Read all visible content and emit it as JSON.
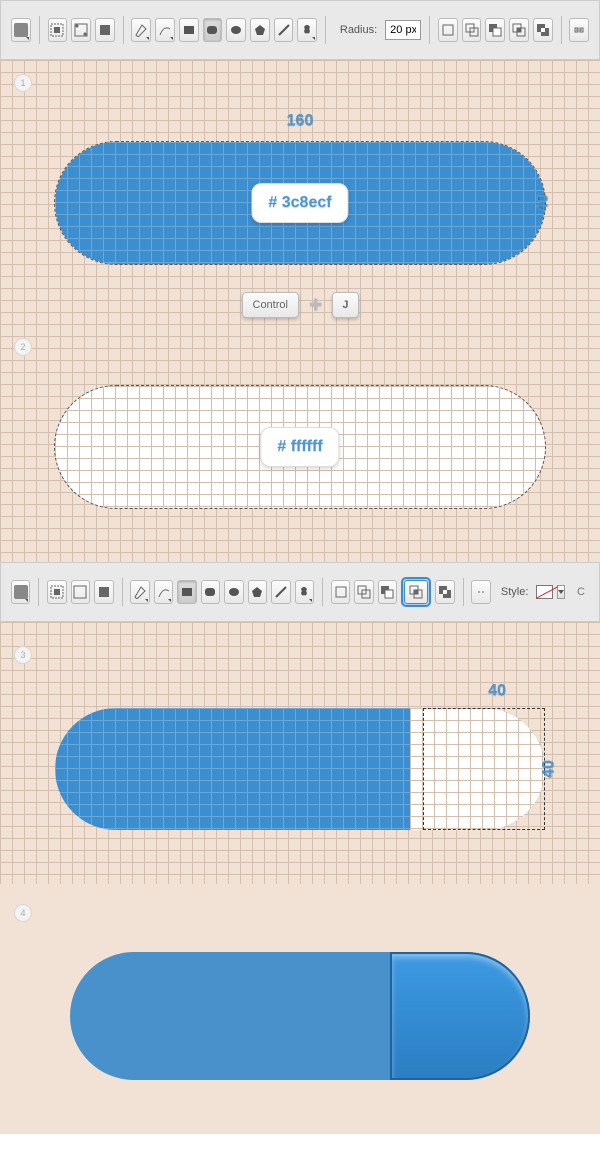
{
  "toolbar1": {
    "radius_label": "Radius:",
    "radius_value": "20 px"
  },
  "toolbar2": {
    "style_label": "Style:"
  },
  "steps": {
    "s1": {
      "num": "1",
      "width_dim": "160",
      "height_dim": "40",
      "hex": "# 3c8ecf"
    },
    "keys": {
      "ctrl": "Control",
      "j": "J"
    },
    "s2": {
      "num": "2",
      "hex": "# ffffff"
    },
    "s3": {
      "num": "3",
      "width_dim": "40",
      "height_dim": "40"
    },
    "s4": {
      "num": "4"
    }
  }
}
